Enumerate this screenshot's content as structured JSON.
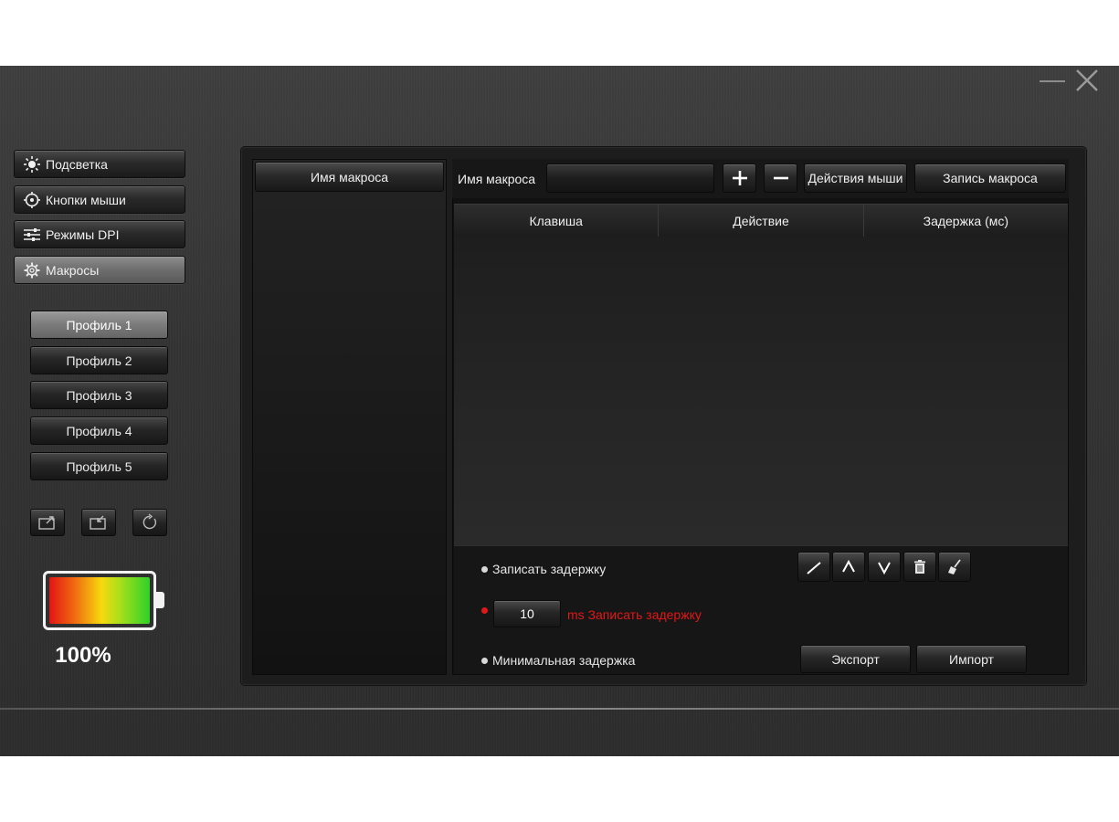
{
  "window": {
    "minimize_icon": "minimize-icon",
    "close_icon": "close-icon"
  },
  "nav": {
    "items": [
      {
        "label": "Подсветка",
        "icon": "sun-icon"
      },
      {
        "label": "Кнопки мыши",
        "icon": "crosshair-icon"
      },
      {
        "label": "Режимы DPI",
        "icon": "sliders-icon"
      },
      {
        "label": "Макросы",
        "icon": "gear-icon"
      }
    ],
    "active_index": 3
  },
  "profiles": {
    "items": [
      "Профиль 1",
      "Профиль 2",
      "Профиль 3",
      "Профиль 4",
      "Профиль 5"
    ],
    "active_index": 0
  },
  "profile_actions": [
    "export-profile-icon",
    "import-profile-icon",
    "reset-icon"
  ],
  "battery": {
    "level": 1.0,
    "label": "100%",
    "colors": [
      "#e21414",
      "#f7d90e",
      "#2fd02a"
    ]
  },
  "macro_list": {
    "header": "Имя макроса",
    "items": []
  },
  "editor": {
    "name_label": "Имя макроса",
    "name_value": "",
    "add_icon": "plus-icon",
    "remove_icon": "minus-icon",
    "mouse_actions_label": "Действия мыши",
    "record_label": "Запись макроса",
    "columns": [
      "Клавиша",
      "Действие",
      "Задержка (мс)"
    ],
    "rows": []
  },
  "options": {
    "record_delay": "Записать задержку",
    "fixed_delay_value": "10",
    "fixed_delay_label": "ms Записать задержку",
    "min_delay": "Минимальная задержка",
    "selected": "fixed"
  },
  "edit_tools": [
    "edit-icon",
    "move-up-icon",
    "move-down-icon",
    "trash-icon",
    "clear-icon"
  ],
  "actions": {
    "export": "Экспорт",
    "import": "Импорт"
  },
  "colors": {
    "accent_red": "#e01818",
    "text": "#f0f0f0"
  }
}
